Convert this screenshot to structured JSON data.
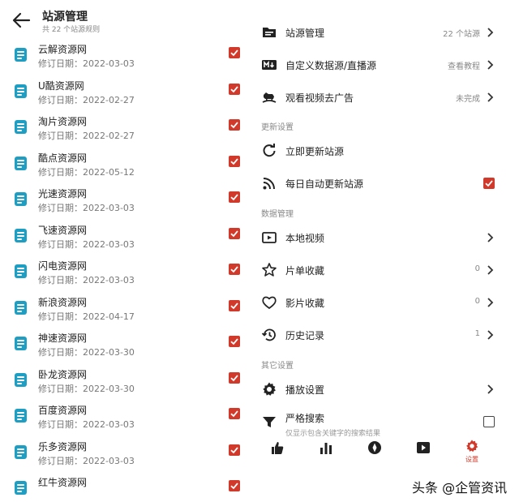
{
  "colors": {
    "accent": "#d13a2b",
    "doc_icon": "#1f9ec3"
  },
  "header": {
    "back_icon": "arrow-left-icon",
    "title": "站源管理",
    "subtitle": "共 22 个站源规则"
  },
  "sources": [
    {
      "name": "云解资源网",
      "date": "修订日期：2022-03-03",
      "checked": true
    },
    {
      "name": "U酷资源网",
      "date": "修订日期：2022-02-27",
      "checked": true
    },
    {
      "name": "淘片资源网",
      "date": "修订日期：2022-02-27",
      "checked": true
    },
    {
      "name": "酷点资源网",
      "date": "修订日期：2022-05-12",
      "checked": true
    },
    {
      "name": "光速资源网",
      "date": "修订日期：2022-03-03",
      "checked": true
    },
    {
      "name": "飞速资源网",
      "date": "修订日期：2022-03-03",
      "checked": true
    },
    {
      "name": "闪电资源网",
      "date": "修订日期：2022-03-03",
      "checked": true
    },
    {
      "name": "新浪资源网",
      "date": "修订日期：2022-04-17",
      "checked": true
    },
    {
      "name": "神速资源网",
      "date": "修订日期：2022-03-30",
      "checked": true
    },
    {
      "name": "卧龙资源网",
      "date": "修订日期：2022-03-30",
      "checked": true
    },
    {
      "name": "百度资源网",
      "date": "修订日期：2022-03-03",
      "checked": true
    },
    {
      "name": "乐多资源网",
      "date": "修订日期：2022-03-03",
      "checked": true
    },
    {
      "name": "红牛资源网",
      "date": "",
      "checked": true
    }
  ],
  "settings": {
    "source_manage": {
      "label": "站源管理",
      "value": "22 个站源"
    },
    "custom_source": {
      "label": "自定义数据源/直播源",
      "value": "查看教程"
    },
    "ad_free": {
      "label": "观看视频去广告",
      "value": "未完成"
    },
    "section_update": "更新设置",
    "update_now": {
      "label": "立即更新站源"
    },
    "auto_update": {
      "label": "每日自动更新站源",
      "checked": true
    },
    "section_data": "数据管理",
    "local_video": {
      "label": "本地视频"
    },
    "playlist_fav": {
      "label": "片单收藏",
      "value": "0"
    },
    "movie_fav": {
      "label": "影片收藏",
      "value": "0"
    },
    "history": {
      "label": "历史记录",
      "value": "1"
    },
    "section_other": "其它设置",
    "play_settings": {
      "label": "播放设置"
    },
    "strict_search": {
      "label": "严格搜索",
      "sub": "仅显示包含关键字的搜索结果",
      "checked": false
    }
  },
  "bottom_nav": {
    "items": [
      "thumb-icon",
      "bar-chart-icon",
      "compass-icon",
      "play-square-icon",
      "gear-icon"
    ],
    "active_label": "设置"
  },
  "watermark": "头条 @企管资讯"
}
